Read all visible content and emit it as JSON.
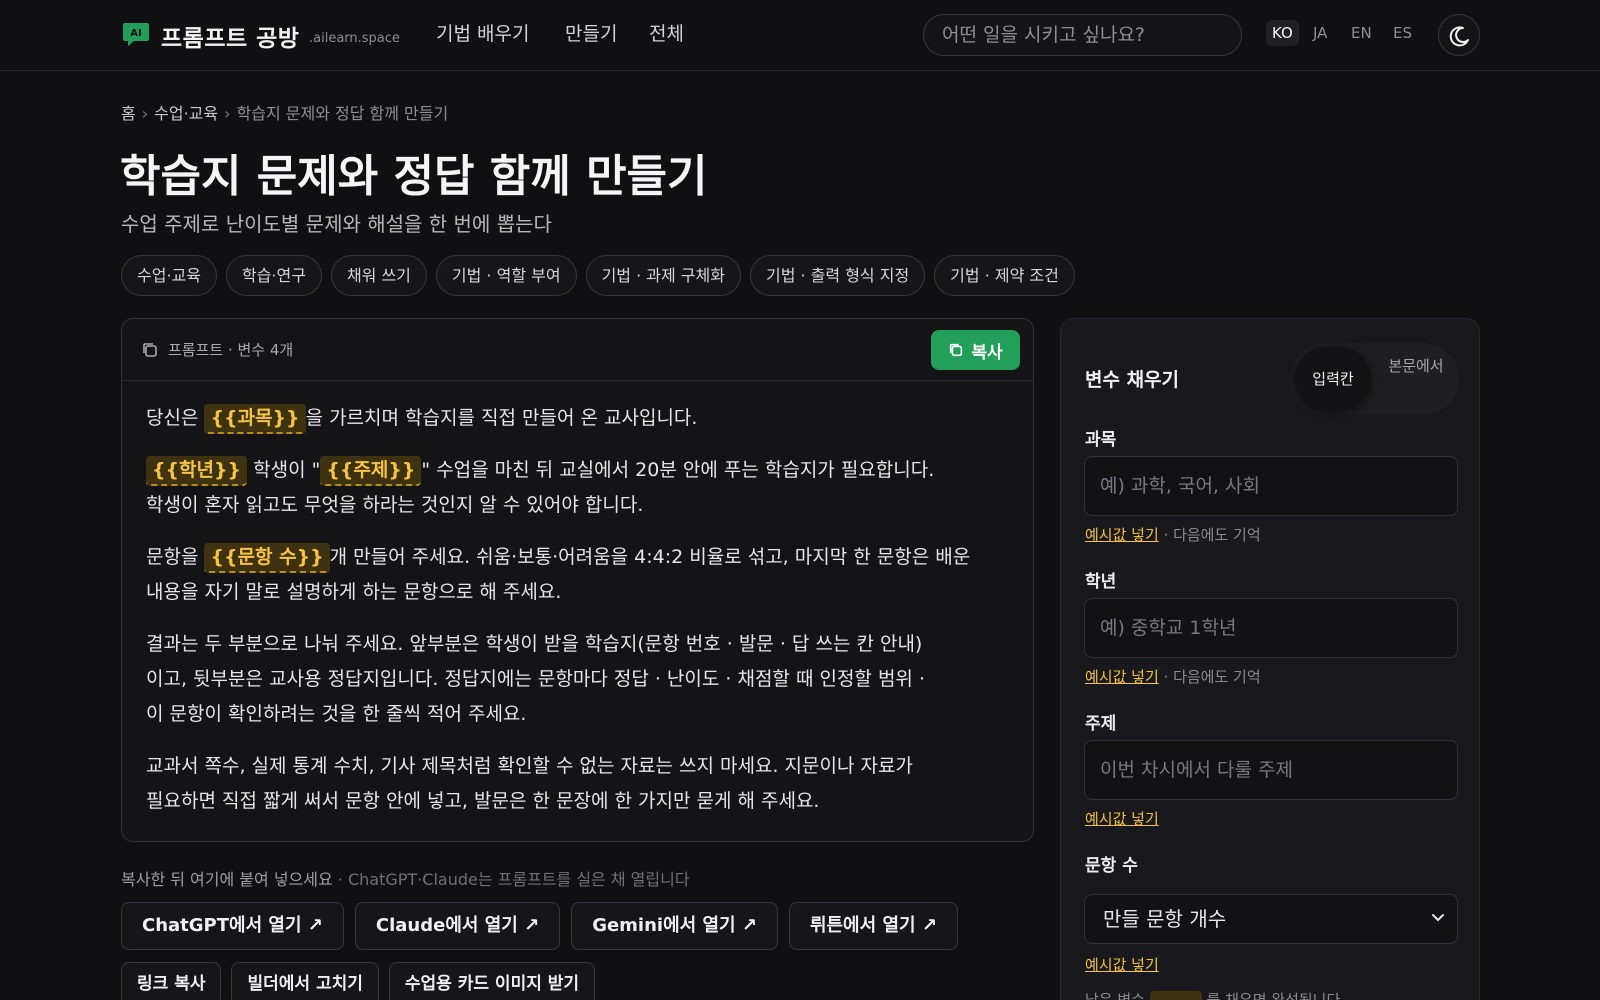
{
  "header": {
    "brand": "프롬프트 공방",
    "domain": ".ailearn.space",
    "nav": [
      "기법 배우기",
      "만들기",
      "전체"
    ],
    "search_placeholder": "어떤 일을 시키고 싶나요?",
    "languages": [
      "KO",
      "JA",
      "EN",
      "ES"
    ],
    "active_language": "KO",
    "theme_icon": "moon-icon",
    "logo_text": "AI",
    "accent_color": "#22a05a"
  },
  "breadcrumb": {
    "home": "홈",
    "sep": "›",
    "category": "수업·교육",
    "current": "학습지 문제와 정답 함께 만들기"
  },
  "page": {
    "title": "학습지 문제와 정답 함께 만들기",
    "subtitle": "수업 주제로 난이도별 문제와 해설을 한 번에 뽑는다"
  },
  "tags": [
    "수업·교육",
    "학습·연구",
    "채워 쓰기",
    "기법 · 역할 부여",
    "기법 · 과제 구체화",
    "기법 · 출력 형식 지정",
    "기법 · 제약 조건"
  ],
  "prompt_card": {
    "label": "프롬프트 · 변수 4개",
    "copy_label": "복사",
    "p1": {
      "a": "당신은 ",
      "v1": "{{과목}}",
      "b": "을 가르치며 학습지를 직접 만들어 온 교사입니다."
    },
    "p2": {
      "v1": "{{학년}}",
      "a": " 학생이 \"",
      "v2": "{{주제}}",
      "b": "\" 수업을 마친 뒤 교실에서 20분 안에 푸는 학습지가 필요합니다.",
      "c": "학생이 혼자 읽고도 무엇을 하라는 것인지 알 수 있어야 합니다."
    },
    "p3": {
      "a": "문항을 ",
      "v1": "{{문항 수}}",
      "b": "개 만들어 주세요. 쉬움·보통·어려움을 4:4:2 비율로 섞고, 마지막 한 문항은 배운",
      "c": "내용을 자기 말로 설명하게 하는 문항으로 해 주세요."
    },
    "p4": {
      "a": "결과는 두 부분으로 나눠 주세요. 앞부분은 학생이 받을 학습지(문항 번호 · 발문 · 답 쓰는 칸 안내)",
      "b": "이고, 뒷부분은 교사용 정답지입니다. 정답지에는 문항마다 정답 · 난이도 · 채점할 때 인정할 범위 ·",
      "c": "이 문항이 확인하려는 것을 한 줄씩 적어 주세요."
    },
    "p5": {
      "a": "교과서 쪽수, 실제 통계 수치, 기사 제목처럼 확인할 수 없는 자료는 쓰지 마세요. 지문이나 자료가",
      "b": "필요하면 직접 짧게 써서 문항 안에 넣고, 발문은 한 문장에 한 가지만 묻게 해 주세요."
    }
  },
  "paste_note": {
    "main": "복사한 뒤 여기에 붙여 넣으세요",
    "sub": " · ChatGPT·Claude는 프롬프트를 실은 채 열립니다"
  },
  "open_buttons": [
    "ChatGPT에서 열기 ↗",
    "Claude에서 열기 ↗",
    "Gemini에서 열기 ↗",
    "뤼튼에서 열기 ↗"
  ],
  "util_buttons": [
    "링크 복사",
    "빌더에서 고치기",
    "수업용 카드 이미지 받기"
  ],
  "side": {
    "title": "변수 채우기",
    "toggle_on": "입력칸",
    "toggle_off": "본문에서",
    "fields": [
      {
        "label": "과목",
        "placeholder": "예) 과학, 국어, 사회",
        "example": "예시값 넣기",
        "remember": " · 다음에도 기억"
      },
      {
        "label": "학년",
        "placeholder": "예) 중학교 1학년",
        "example": "예시값 넣기",
        "remember": " · 다음에도 기억"
      },
      {
        "label": "주제",
        "placeholder": "이번 차시에서 다룰 주제",
        "example": "예시값 넣기"
      },
      {
        "label": "문항 수",
        "select_value": "만들 문항 개수",
        "example": "예시값 넣기"
      }
    ],
    "footer": "남은 변수",
    "footer_tail": "를 채우면 완성됩니다"
  }
}
